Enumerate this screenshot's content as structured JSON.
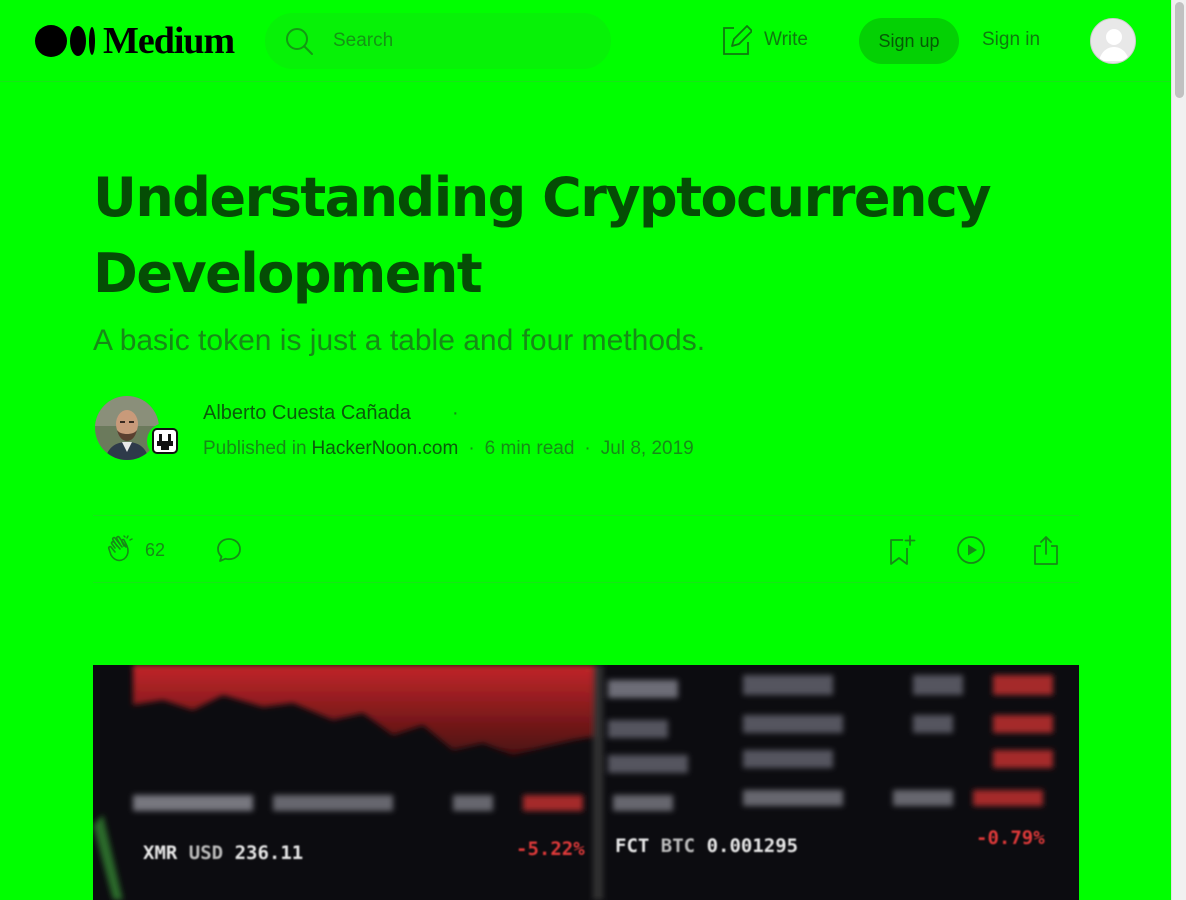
{
  "header": {
    "logo_text": "Medium",
    "search_placeholder": "Search",
    "write_label": "Write",
    "signup_label": "Sign up",
    "signin_label": "Sign in"
  },
  "article": {
    "title": "Understanding Cryptocurrency Development",
    "subtitle": "A basic token is just a table and four methods.",
    "author": "Alberto Cuesta Cañada",
    "author_dot": "·",
    "published_in_label": "Published in",
    "publication": "HackerNoon.com",
    "read_time": "6 min read",
    "date": "Jul 8, 2019",
    "separator": "·"
  },
  "actions": {
    "clap_count": "62"
  },
  "hero": {
    "ticker_left_symbol": "XMR",
    "ticker_left_currency": "USD",
    "ticker_left_value": "236.11",
    "ticker_left_change": "-5.22%",
    "ticker_right_symbol": "FCT",
    "ticker_right_currency": "BTC",
    "ticker_right_value": "0.001295",
    "ticker_right_change": "-0.79%"
  },
  "colors": {
    "background": "#00ff00",
    "title": "#054d05",
    "text_muted": "#178a17",
    "signup_bg": "#04d104"
  }
}
